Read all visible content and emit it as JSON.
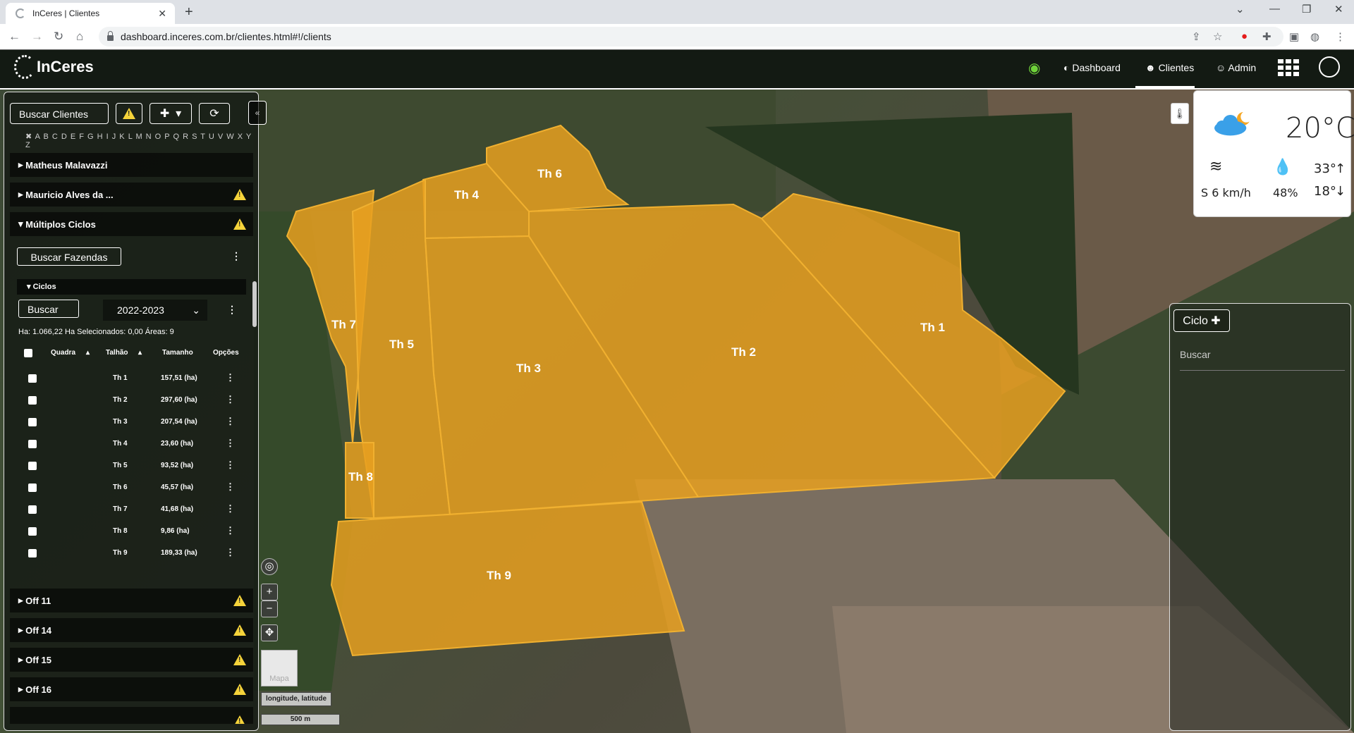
{
  "browser": {
    "tab_title": "InCeres | Clientes",
    "url": "dashboard.inceres.com.br/clientes.html#!/clients"
  },
  "app": {
    "logo": "InCeres",
    "nav": {
      "dashboard": "Dashboard",
      "clientes": "Clientes",
      "admin": "Admin"
    }
  },
  "sidebar": {
    "search_placeholder": "Buscar Clientes",
    "alphabet": "✖ A B C D E F G H I J K L M N O P Q R S T U V W X Y Z",
    "clients": [
      {
        "name": "Matheus Malavazzi",
        "warning": false
      },
      {
        "name": "Mauricio Alves da ...",
        "warning": true
      },
      {
        "name": "Múltiplos Ciclos",
        "warning": true
      }
    ],
    "buscar_fazendas": "Buscar Fazendas",
    "ciclos_header": "Ciclos",
    "buscar_button": "Buscar",
    "season": "2022-2023",
    "stats": "Ha: 1.066,22    Ha Selecionados: 0,00    Áreas: 9",
    "table": {
      "headers": [
        "Quadra",
        "Talhão",
        "Tamanho",
        "Opções"
      ],
      "rows": [
        {
          "talhao": "Th 1",
          "tamanho": "157,51 (ha)"
        },
        {
          "talhao": "Th 2",
          "tamanho": "297,60 (ha)"
        },
        {
          "talhao": "Th 3",
          "tamanho": "207,54 (ha)"
        },
        {
          "talhao": "Th 4",
          "tamanho": "23,60 (ha)"
        },
        {
          "talhao": "Th 5",
          "tamanho": "93,52 (ha)"
        },
        {
          "talhao": "Th 6",
          "tamanho": "45,57 (ha)"
        },
        {
          "talhao": "Th 7",
          "tamanho": "41,68 (ha)"
        },
        {
          "talhao": "Th 8",
          "tamanho": "9,86 (ha)"
        },
        {
          "talhao": "Th 9",
          "tamanho": "189,33 (ha)"
        }
      ]
    },
    "farms": [
      {
        "name": "Off 11"
      },
      {
        "name": "Off 14"
      },
      {
        "name": "Off 15"
      },
      {
        "name": "Off 16"
      }
    ]
  },
  "map": {
    "field_labels": [
      "Th 1",
      "Th 2",
      "Th 3",
      "Th 4",
      "Th 5",
      "Th 6",
      "Th 7",
      "Th 8",
      "Th 9"
    ],
    "thumbnail_label": "Mapa",
    "coord_readout": "longitude, latitude",
    "scale_label": "500 m"
  },
  "weather": {
    "temperature": "20°C",
    "wind": "S 6 km/h",
    "humidity": "48%",
    "max": "33°",
    "min": "18°"
  },
  "right_panel": {
    "ciclo_button": "Ciclo",
    "search_placeholder": "Buscar"
  },
  "colors": {
    "field_fill": "#e8a020",
    "warning": "#f5d33a",
    "wifi": "#6fd23a"
  }
}
